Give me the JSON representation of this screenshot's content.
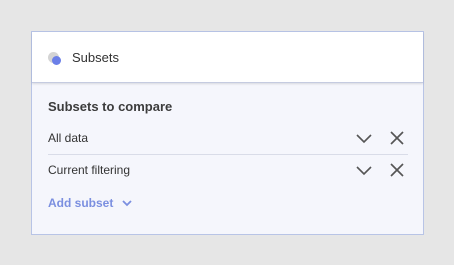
{
  "header": {
    "title": "Subsets",
    "icon": "subsets-icon"
  },
  "section": {
    "title": "Subsets to compare"
  },
  "subsets": [
    {
      "label": "All data"
    },
    {
      "label": "Current filtering"
    }
  ],
  "add_subset": {
    "label": "Add subset"
  },
  "colors": {
    "accent": "#7b8fe0",
    "icon_grey": "#c8c8c8",
    "icon_blue": "#6b7fe8"
  }
}
